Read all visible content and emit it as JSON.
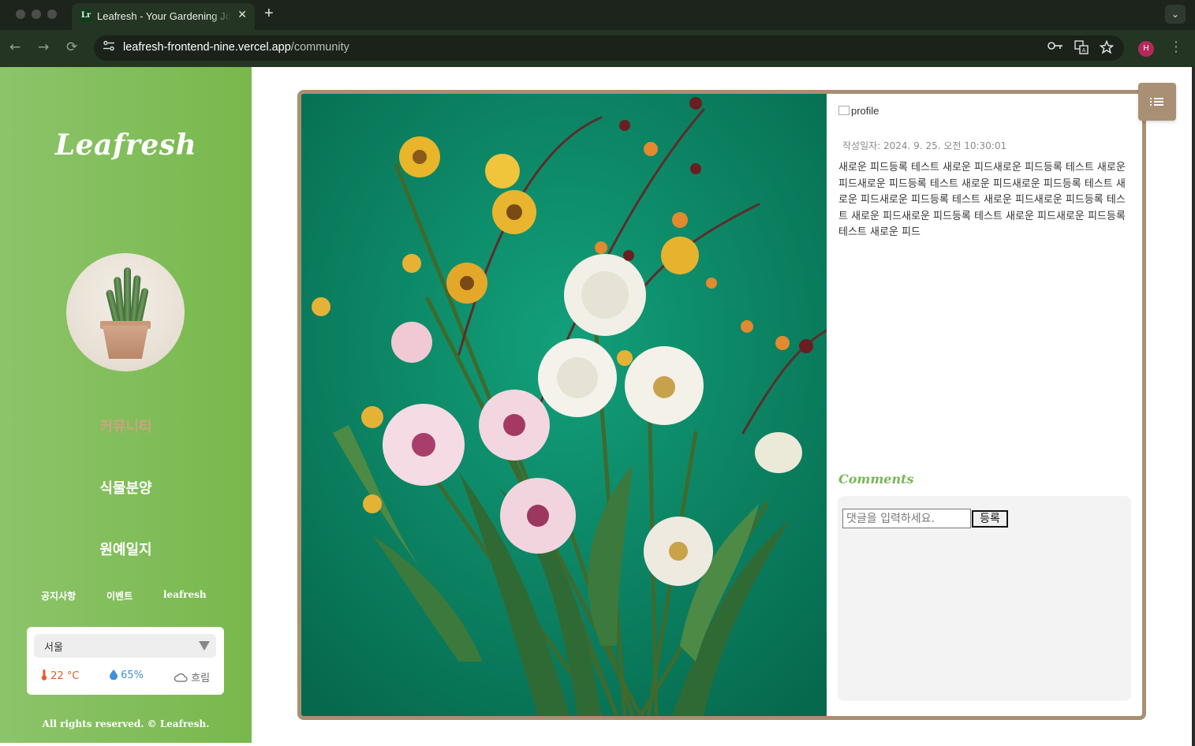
{
  "browser": {
    "tab_favicon": "Lr",
    "tab_title": "Leafresh - Your Gardening Journal",
    "tab_close": "✕",
    "new_tab": "+",
    "tab_dropdown": "⌄",
    "url_host": "leafresh-frontend-nine.vercel.app",
    "url_path": "/community",
    "profile_initial": "H",
    "back": "←",
    "forward": "→",
    "reload": "⟳",
    "menu": "⋮"
  },
  "sidebar": {
    "brand": "Leafresh",
    "nav": [
      {
        "label": "커뮤니티",
        "active": true
      },
      {
        "label": "식물분양",
        "active": false
      },
      {
        "label": "원예일지",
        "active": false
      }
    ],
    "sub_links": [
      "공지사항",
      "이벤트",
      "leafresh"
    ],
    "footer": "All rights reserved. © Leafresh."
  },
  "weather": {
    "city": "서울",
    "temperature": "22 °C",
    "humidity": "65%",
    "sky": "흐림"
  },
  "post": {
    "profile_alt": "profile",
    "date_label": "작성일자: 2024. 9. 25. 오전 10:30:01",
    "body": "새로운 피드등록 테스트 새로운 피드새로운 피드등록 테스트 새로운 피드새로운 피드등록 테스트 새로운 피드새로운 피드등록 테스트 새로운 피드새로운 피드등록 테스트 새로운 피드새로운 피드등록 테스트 새로운 피드새로운 피드등록 테스트 새로운 피드새로운 피드등록 테스트 새로운 피드"
  },
  "comments": {
    "title": "Comments",
    "placeholder": "댓글을 입력하세요.",
    "submit": "등록"
  },
  "colors": {
    "sidebar": "#7ab657",
    "accent_brown": "#a98f73",
    "active_nav": "#c9a67e"
  }
}
